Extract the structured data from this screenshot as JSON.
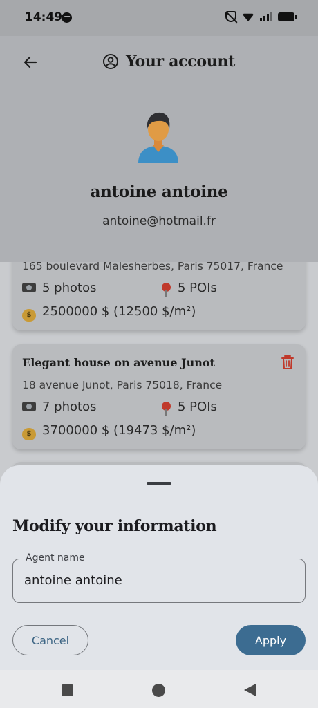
{
  "status_bar": {
    "time": "14:49",
    "icons": [
      "messenger-icon",
      "mute-icon",
      "wifi-icon",
      "signal-icon",
      "battery-icon"
    ]
  },
  "header": {
    "title": "Your account",
    "back_icon": "arrow-left-icon",
    "title_icon": "account-circle-icon",
    "user_name": "antoine antoine",
    "user_email": "antoine@hotmail.fr"
  },
  "properties": [
    {
      "title": "",
      "address": "165 boulevard Malesherbes, Paris 75017, France",
      "photos": "5 photos",
      "pois": "5 POIs",
      "price": "2500000 $ (12500 $/m²)"
    },
    {
      "title": "Elegant house on avenue Junot",
      "address": "18 avenue Junot, Paris 75018, France",
      "photos": "7 photos",
      "pois": "5 POIs",
      "price": "3700000 $ (19473 $/m²)"
    }
  ],
  "sheet": {
    "title": "Modify your information",
    "field_label": "Agent name",
    "field_value": "antoine antoine",
    "cancel_label": "Cancel",
    "apply_label": "Apply"
  },
  "colors": {
    "primary": "#3c6c91",
    "delete": "#c0392b",
    "sheet_bg": "#e1e4e9"
  }
}
